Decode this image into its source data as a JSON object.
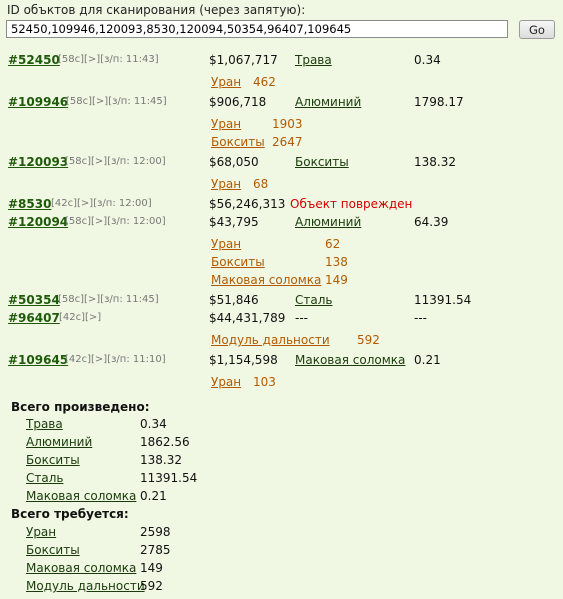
{
  "header": {
    "label": "ID объктов для сканирования (через запятую):",
    "input_value": "52450,109946,120093,8530,120094,50354,96407,109645",
    "go_label": "Go"
  },
  "objects": [
    {
      "id": "#52450",
      "meta": "[58c][>][з/п: 11:43]",
      "price": "$1,067,717",
      "resource": "Трава",
      "value": "0.34",
      "requirements": [
        {
          "name": "Уран",
          "qty": "462"
        }
      ]
    },
    {
      "id": "#109946",
      "meta": "[58c][>][з/п: 11:45]",
      "price": "$906,718",
      "resource": "Алюминий",
      "value": "1798.17",
      "requirements": [
        {
          "name": "Уран",
          "qty": "1903"
        },
        {
          "name": "Бокситы",
          "qty": "2647"
        }
      ]
    },
    {
      "id": "#120093",
      "meta": "[58c][>][з/п: 12:00]",
      "price": "$68,050",
      "resource": "Бокситы",
      "value": "138.32",
      "requirements": [
        {
          "name": "Уран",
          "qty": "68"
        }
      ]
    },
    {
      "id": "#8530",
      "meta": "[42c][>][з/п: 12:00]",
      "price": "$56,246,313",
      "damage": "Объект поврежден",
      "requirements": []
    },
    {
      "id": "#120094",
      "meta": "[58c][>][з/п: 12:00]",
      "price": "$43,795",
      "resource": "Алюминий",
      "value": "64.39",
      "requirements": [
        {
          "name": "Уран",
          "qty": "62"
        },
        {
          "name": "Бокситы",
          "qty": "138"
        },
        {
          "name": "Маковая соломка",
          "qty": "149"
        }
      ]
    },
    {
      "id": "#50354",
      "meta": "[58c][>][з/п: 11:45]",
      "price": "$51,846",
      "resource": "Сталь",
      "value": "11391.54",
      "requirements": []
    },
    {
      "id": "#96407",
      "meta": "[42c][>]",
      "price": "$44,431,789",
      "resource_plain": "---",
      "value": "---",
      "requirements": [
        {
          "name": "Модуль дальности",
          "qty": "592"
        }
      ]
    },
    {
      "id": "#109645",
      "meta": "[42c][>][з/п: 11:10]",
      "price": "$1,154,598",
      "resource": "Маковая соломка",
      "value": "0.21",
      "requirements": [
        {
          "name": "Уран",
          "qty": "103"
        }
      ]
    }
  ],
  "produced": {
    "title": "Всего произведено:",
    "items": [
      {
        "name": "Трава",
        "value": "0.34"
      },
      {
        "name": "Алюминий",
        "value": "1862.56"
      },
      {
        "name": "Бокситы",
        "value": "138.32"
      },
      {
        "name": "Сталь",
        "value": "11391.54"
      },
      {
        "name": "Маковая соломка",
        "value": "0.21"
      }
    ]
  },
  "required": {
    "title": "Всего требуется:",
    "items": [
      {
        "name": "Уран",
        "value": "2598"
      },
      {
        "name": "Бокситы",
        "value": "2785"
      },
      {
        "name": "Маковая соломка",
        "value": "149"
      },
      {
        "name": "Модуль дальности",
        "value": "592"
      }
    ]
  }
}
